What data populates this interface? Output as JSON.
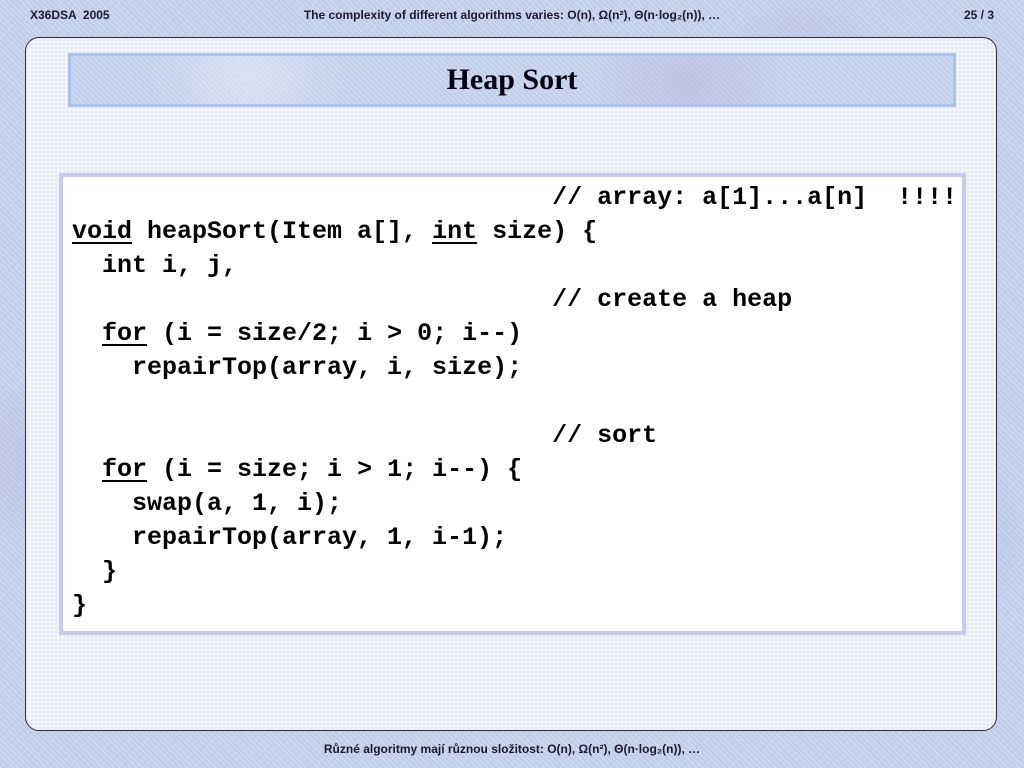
{
  "header": {
    "left": "X36DSA  2005",
    "center": "The complexity of different algorithms varies:  O(n), Ω(n²), Θ(n·log₂(n)), …",
    "right": "25 / 3"
  },
  "slide": {
    "title": "Heap Sort",
    "code": {
      "line1": {
        "text": "                                // array: a[1]...a[n]  !!!!"
      },
      "line2": {
        "kw1": "void",
        "mid": " heapSort(Item a[], ",
        "kw2": "int",
        "rest": " size) {"
      },
      "line3": {
        "text": "  int i, j,"
      },
      "line4": {
        "text": "                                // create a heap"
      },
      "line5": {
        "indent": "  ",
        "kw": "for",
        "rest": " (i = size/2; i > 0; i--)"
      },
      "line6": {
        "text": "    repairTop(array, i, size);"
      },
      "line7": {
        "text": ""
      },
      "line8": {
        "text": "                                // sort"
      },
      "line9": {
        "indent": "  ",
        "kw": "for",
        "rest": " (i = size; i > 1; i--) {"
      },
      "line10": {
        "text": "    swap(a, 1, i);"
      },
      "line11": {
        "text": "    repairTop(array, 1, i-1);"
      },
      "line12": {
        "text": "  }"
      },
      "line13": {
        "text": "}"
      }
    }
  },
  "footer": {
    "text": "Různé algoritmy mají různou složitost:  O(n), Ω(n²), Θ(n·log₂(n)), …"
  }
}
